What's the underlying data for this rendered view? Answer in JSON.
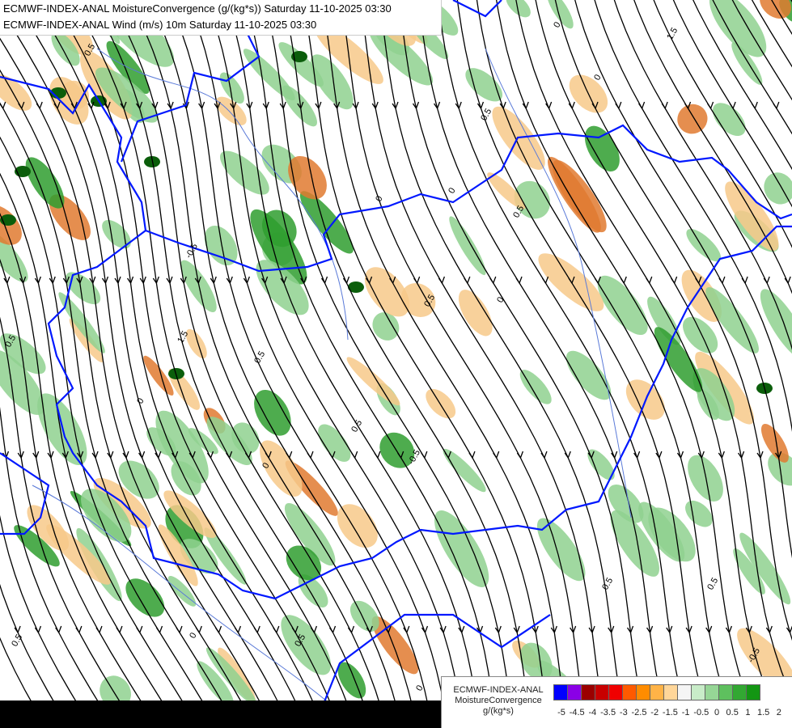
{
  "title": {
    "line1": "ECMWF-INDEX-ANAL MoistureConvergence (g/(kg*s)) Saturday 11-10-2025 03:30",
    "line2": "ECMWF-INDEX-ANAL Wind (m/s) 10m Saturday 11-10-2025 03:30"
  },
  "legend": {
    "line1": "ECMWF-INDEX-ANAL",
    "line2": "MoistureConvergence",
    "line3": "g/(kg*s)",
    "swatches": [
      "#0000ff",
      "#8a00e6",
      "#9b0000",
      "#c80000",
      "#f00000",
      "#ff5a00",
      "#ff8c00",
      "#ffb347",
      "#ffd699",
      "#f5f5f5",
      "#c8ecc8",
      "#96d696",
      "#5ec05e",
      "#32a832",
      "#139613"
    ],
    "ticks": [
      "-5",
      "-4.5",
      "-4",
      "-3.5",
      "-3",
      "-2.5",
      "-2",
      "-1.5",
      "-1",
      "-0.5",
      "0",
      "0.5",
      "1",
      "1.5",
      "2"
    ]
  },
  "contour_labels": [
    "0.5",
    "0",
    "-0.5",
    "1.5",
    "0.5",
    "0",
    "0.5",
    "0",
    "-0.5",
    "0.5",
    "0",
    "0.5",
    "0",
    "0.5",
    "0",
    "0.5",
    "1.5",
    "0.5",
    "-0.5",
    "0",
    "0.5",
    "0",
    "0.5",
    "0",
    "0.5"
  ],
  "colors": {
    "border": "#0018ff",
    "river": "#5a7ad8",
    "streamline": "#000000",
    "positive": "#8fd18f",
    "strong_positive": "#2f9e2f",
    "negative": "#f7c98a",
    "strong_negative": "#e07a30"
  }
}
